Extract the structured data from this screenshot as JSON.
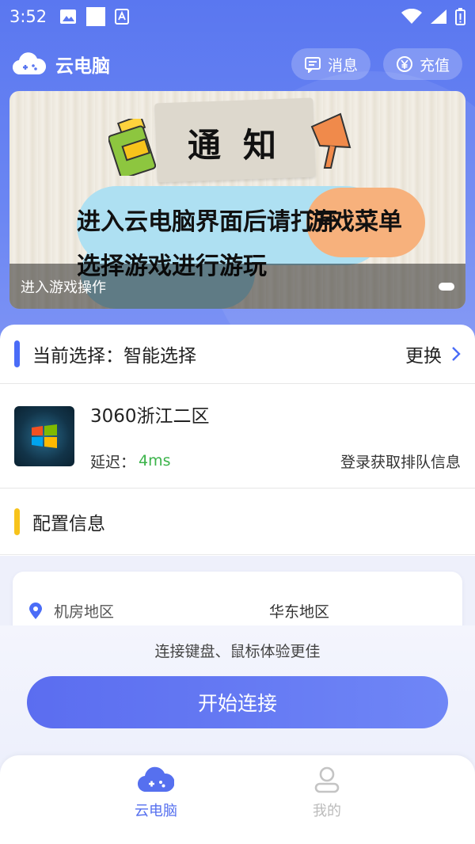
{
  "status_bar": {
    "time": "3:52"
  },
  "header": {
    "title": "云电脑",
    "messages_label": "消息",
    "recharge_label": "充值"
  },
  "banner": {
    "heading": "通知",
    "line1": "进入云电脑界面后请打开",
    "highlight": "游戏菜单",
    "line2": "选择游戏进行游玩",
    "caption": "进入游戏操作"
  },
  "selection": {
    "title": "当前选择：智能选择",
    "change_label": "更换"
  },
  "server": {
    "name": "3060浙江二区",
    "latency_label": "延迟：",
    "latency_value": "4ms",
    "queue_link": "登录获取排队信息"
  },
  "config": {
    "title": "配置信息"
  },
  "region": {
    "label": "机房地区",
    "value": "华东地区"
  },
  "connect": {
    "hint": "连接键盘、鼠标体验更佳",
    "button_label": "开始连接"
  },
  "tabs": [
    {
      "label": "云电脑",
      "active": true
    },
    {
      "label": "我的",
      "active": false
    }
  ],
  "colors": {
    "primary": "#5a77f0",
    "accent_blue": "#4a6cf7",
    "accent_yellow": "#f7c31b",
    "latency_green": "#3bb34a"
  }
}
